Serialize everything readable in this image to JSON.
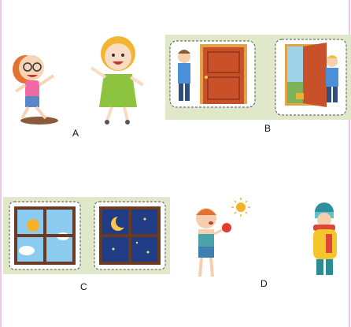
{
  "options": {
    "a": {
      "label": "A"
    },
    "b": {
      "label": "B"
    },
    "c": {
      "label": "C"
    },
    "d": {
      "label": "D"
    }
  },
  "colors": {
    "panel_bg": "#dfe8c9",
    "door": "#c8512a",
    "window_frame": "#6b3a22",
    "day_sky": "#8ccbf0",
    "night_sky": "#1f3c84",
    "sun": "#f6b12a"
  }
}
